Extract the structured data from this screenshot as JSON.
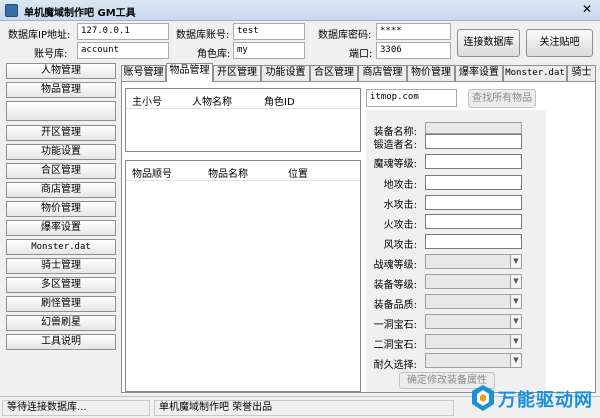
{
  "window": {
    "title": "单机魔域制作吧 GM工具",
    "close_glyph": "✕"
  },
  "connection": {
    "db_ip_label": "数据库IP地址:",
    "db_ip_value": "127.0.0.1",
    "db_account_label": "数据库账号:",
    "db_account_value": "test",
    "db_password_label": "数据库密码:",
    "db_password_value": "****",
    "account_db_label": "账号库:",
    "account_db_value": "account",
    "role_db_label": "角色库:",
    "role_db_value": "my",
    "port_label": "端口:",
    "port_value": "3306",
    "connect_button": "连接数据库",
    "follow_button": "关注贴吧"
  },
  "sidebar": {
    "items": [
      {
        "label": "人物管理"
      },
      {
        "label": "物品管理"
      },
      {
        "label": ""
      },
      {
        "label": "开区管理"
      },
      {
        "label": "功能设置"
      },
      {
        "label": "合区管理"
      },
      {
        "label": "商店管理"
      },
      {
        "label": "物价管理"
      },
      {
        "label": "爆率设置"
      },
      {
        "label": "Monster.dat"
      },
      {
        "label": "骑士管理"
      },
      {
        "label": "多区管理"
      },
      {
        "label": "刷怪管理"
      },
      {
        "label": "幻兽刷星"
      },
      {
        "label": "工具说明"
      }
    ]
  },
  "tabs": [
    {
      "label": "账号管理"
    },
    {
      "label": "物品管理"
    },
    {
      "label": "开区管理"
    },
    {
      "label": "功能设置"
    },
    {
      "label": "合区管理"
    },
    {
      "label": "商店管理"
    },
    {
      "label": "物价管理"
    },
    {
      "label": "爆率设置"
    },
    {
      "label": "Monster.dat"
    },
    {
      "label": "骑士"
    }
  ],
  "item_panel": {
    "role_list_headers": [
      "主小号",
      "人物名称",
      "角色ID"
    ],
    "item_list_headers": [
      "物品顺号",
      "物品名称",
      "位置"
    ],
    "search_value": "itmop.com",
    "search_button": "查找所有物品",
    "fields": {
      "equip_name": "装备名称:",
      "forger": "锻造者名:",
      "soul_level": "魔魂等级:",
      "earth_attack": "地攻击:",
      "water_attack": "水攻击:",
      "fire_attack": "火攻击:",
      "wind_attack": "风攻击:",
      "war_soul_level": "战魂等级:",
      "equip_level": "装备等级:",
      "equip_quality": "装备品质:",
      "gem_hole_1": "一洞宝石:",
      "gem_hole_2": "二洞宝石:",
      "durability": "耐久选择:"
    },
    "confirm_button": "确定修改装备属性"
  },
  "statusbar": {
    "status": "等待连接数据库...",
    "credit": "单机魔域制作吧 荣誉出品"
  },
  "watermark": {
    "text": "万能驱动网"
  }
}
